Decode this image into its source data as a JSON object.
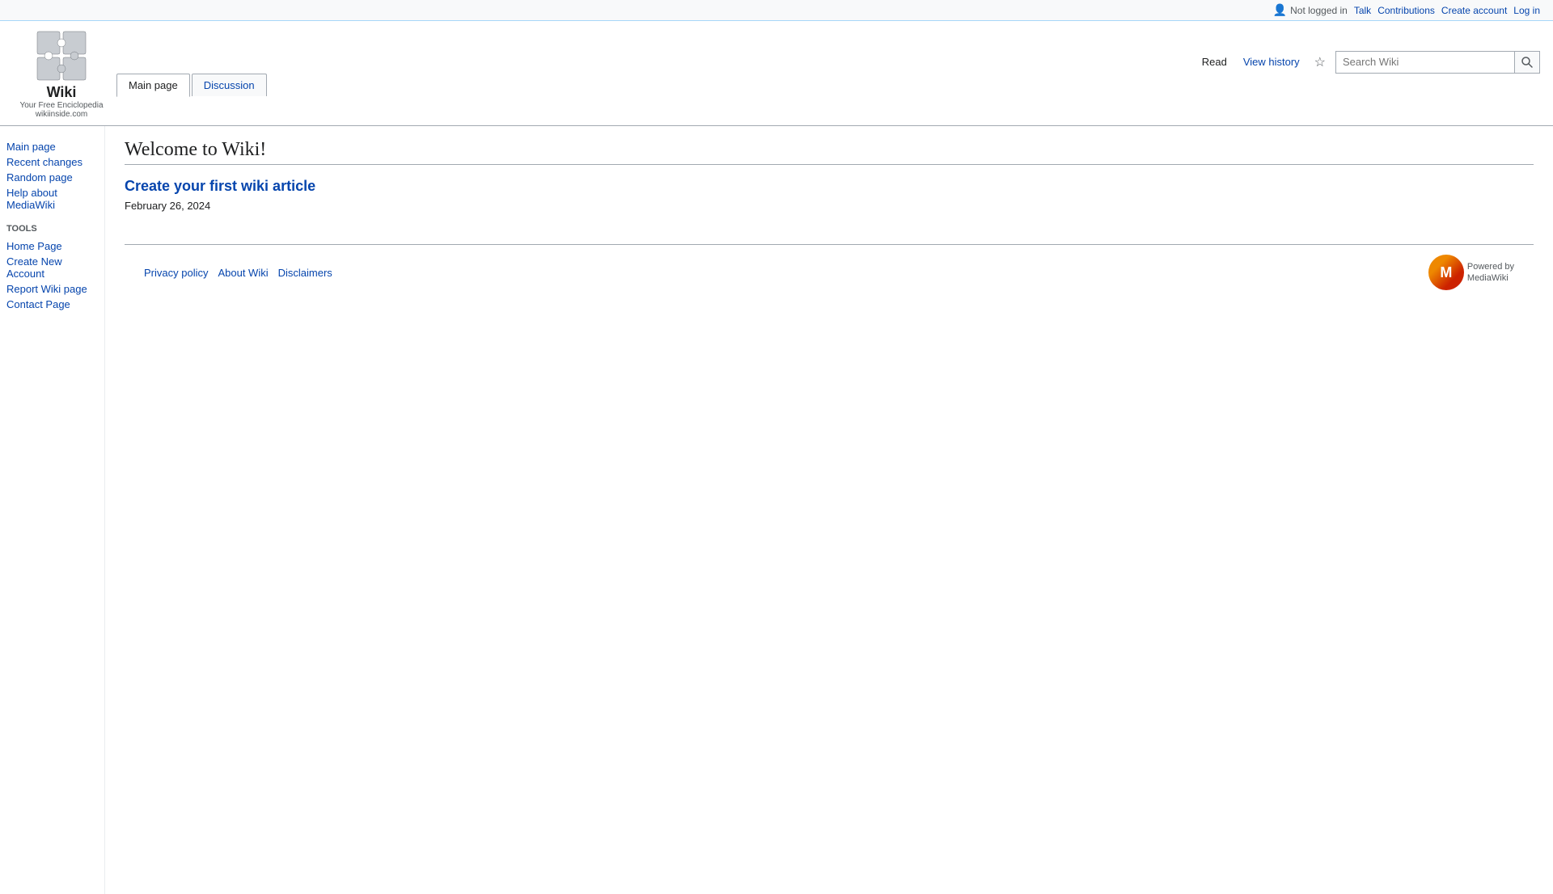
{
  "topbar": {
    "not_logged_in": "Not logged in",
    "talk_label": "Talk",
    "contributions_label": "Contributions",
    "create_account_label": "Create account",
    "login_label": "Log in"
  },
  "logo": {
    "title": "Wiki",
    "subtitle": "Your Free Enciclopedia",
    "domain": "wikiinside.com"
  },
  "tabs": {
    "main_page": "Main page",
    "discussion": "Discussion"
  },
  "header_actions": {
    "read": "Read",
    "view_history": "View history"
  },
  "search": {
    "placeholder": "Search Wiki",
    "button_label": "Search"
  },
  "sidebar": {
    "navigation_title": "",
    "nav_links": [
      {
        "label": "Main page",
        "href": "#"
      },
      {
        "label": "Recent changes",
        "href": "#"
      },
      {
        "label": "Random page",
        "href": "#"
      },
      {
        "label": "Help about MediaWiki",
        "href": "#"
      }
    ],
    "tools_title": "Tools",
    "tool_links": [
      {
        "label": "Home Page",
        "href": "#"
      },
      {
        "label": "Create New Account",
        "href": "#"
      },
      {
        "label": "Report Wiki page",
        "href": "#"
      },
      {
        "label": "Contact Page",
        "href": "#"
      }
    ]
  },
  "main": {
    "page_title": "Welcome to Wiki!",
    "article_link_text": "Create your first wiki article",
    "article_date": "February 26, 2024"
  },
  "footer": {
    "links": [
      {
        "label": "Privacy policy"
      },
      {
        "label": "About Wiki"
      },
      {
        "label": "Disclaimers"
      }
    ],
    "powered_by_line1": "Powered by",
    "powered_by_line2": "MediaWiki"
  }
}
